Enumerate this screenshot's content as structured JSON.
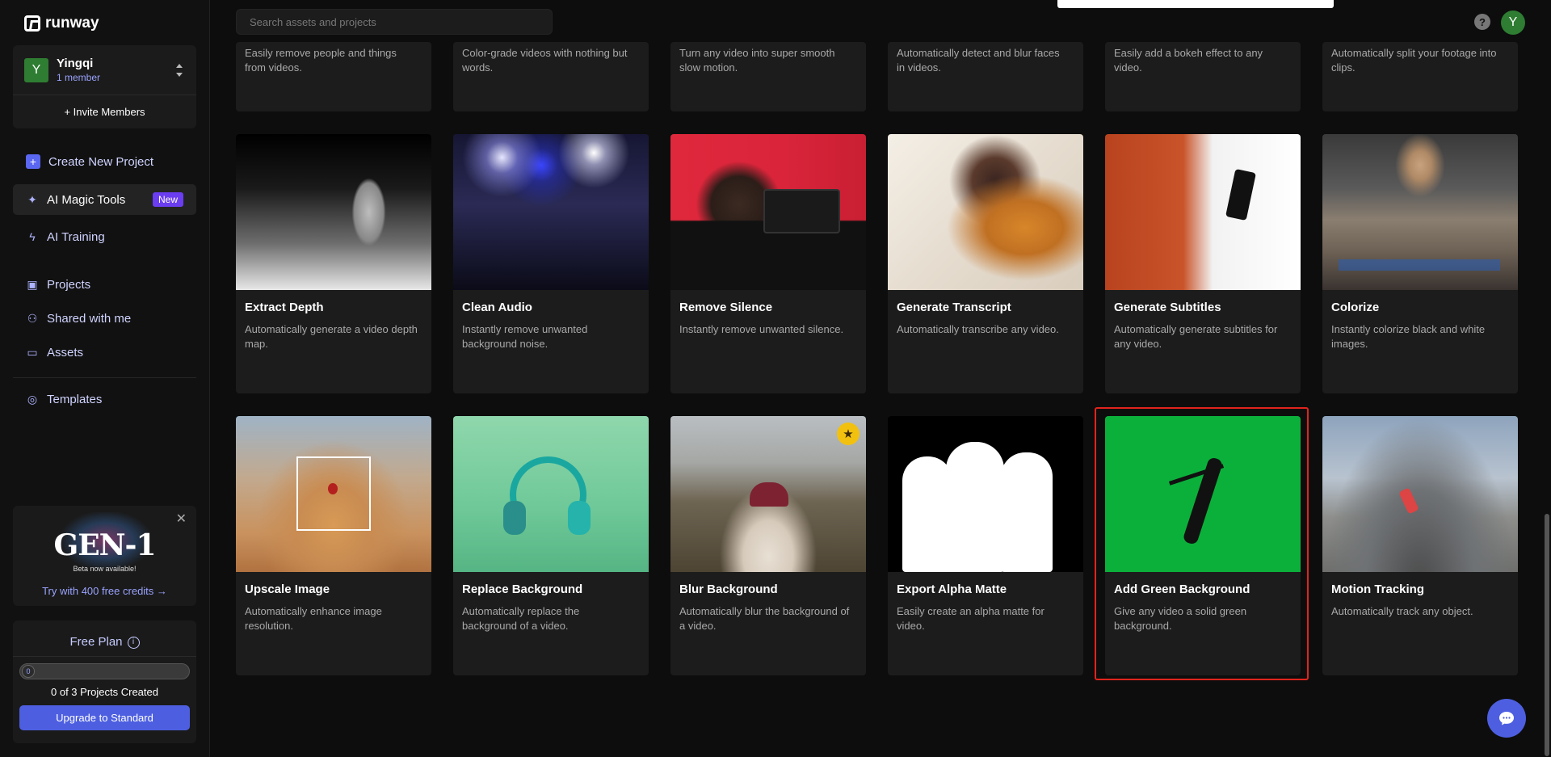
{
  "app": {
    "brand": "runway"
  },
  "search": {
    "placeholder": "Search assets and projects"
  },
  "workspace": {
    "initial": "Y",
    "name": "Yingqi",
    "members": "1 member",
    "invite_label": "+ Invite Members"
  },
  "nav": {
    "create_project": "Create New Project",
    "magic_tools": "AI Magic Tools",
    "magic_badge": "New",
    "training": "AI Training",
    "projects": "Projects",
    "shared": "Shared with me",
    "assets": "Assets",
    "templates": "Templates"
  },
  "promo": {
    "title": "GEN-1",
    "subtitle": "Beta now available!",
    "link": "Try with 400 free credits →"
  },
  "plan": {
    "title": "Free Plan",
    "progress_value": "0",
    "progress_fraction": 0,
    "count": "0 of 3 Projects Created",
    "upgrade": "Upgrade to Standard"
  },
  "user": {
    "initial": "Y",
    "help": "?"
  },
  "top_row": [
    {
      "desc": "Easily remove people and things from videos."
    },
    {
      "desc": "Color-grade videos with nothing but words."
    },
    {
      "desc": "Turn any video into super smooth slow motion."
    },
    {
      "desc": "Automatically detect and blur faces in videos."
    },
    {
      "desc": "Easily add a bokeh effect to any video."
    },
    {
      "desc": "Automatically split your footage into clips."
    }
  ],
  "row2": [
    {
      "title": "Extract Depth",
      "desc": "Automatically generate a video depth map."
    },
    {
      "title": "Clean Audio",
      "desc": "Instantly remove unwanted background noise."
    },
    {
      "title": "Remove Silence",
      "desc": "Instantly remove unwanted silence."
    },
    {
      "title": "Generate Transcript",
      "desc": "Automatically transcribe any video."
    },
    {
      "title": "Generate Subtitles",
      "desc": "Automatically generate subtitles for any video."
    },
    {
      "title": "Colorize",
      "desc": "Instantly colorize black and white images."
    }
  ],
  "row3": [
    {
      "title": "Upscale Image",
      "desc": "Automatically enhance image resolution."
    },
    {
      "title": "Replace Background",
      "desc": "Automatically replace the background of a video."
    },
    {
      "title": "Blur Background",
      "desc": "Automatically blur the background of a video."
    },
    {
      "title": "Export Alpha Matte",
      "desc": "Easily create an alpha matte for video."
    },
    {
      "title": "Add Green Background",
      "desc": "Give any video a solid green background."
    },
    {
      "title": "Motion Tracking",
      "desc": "Automatically track any object."
    }
  ],
  "icons": {
    "star": "star-icon",
    "chat": "chat-icon"
  },
  "colors": {
    "accent": "#4d5fe0",
    "new_badge": "#6b3df0",
    "highlight": "#e0241c",
    "green_screen": "#0bb03a"
  }
}
